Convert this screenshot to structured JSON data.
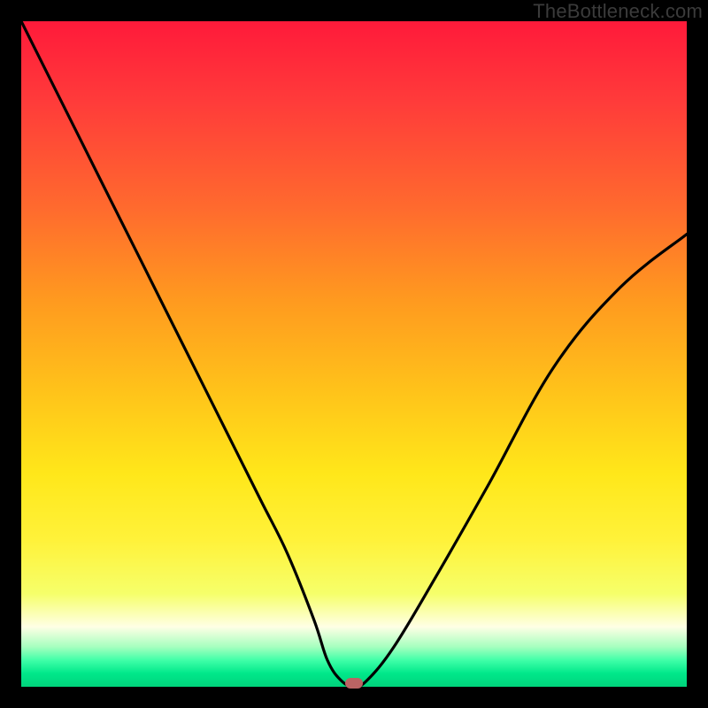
{
  "watermark": "TheBottleneck.com",
  "chart_data": {
    "type": "line",
    "title": "",
    "xlabel": "",
    "ylabel": "",
    "xlim": [
      0,
      100
    ],
    "ylim": [
      0,
      100
    ],
    "series": [
      {
        "name": "curve",
        "x": [
          0,
          6,
          12,
          18,
          24,
          30,
          36,
          40,
          44,
          46,
          48,
          50,
          52,
          56,
          62,
          70,
          80,
          90,
          100
        ],
        "y": [
          100,
          88,
          76,
          64,
          52,
          40,
          28,
          20,
          10,
          4,
          1,
          0,
          1,
          6,
          16,
          30,
          48,
          60,
          68
        ]
      }
    ],
    "marker": {
      "x": 50,
      "y": 0
    },
    "background_gradient": {
      "top": "#ff1a3a",
      "mid": "#ffe71a",
      "bottom": "#00d37c"
    }
  }
}
